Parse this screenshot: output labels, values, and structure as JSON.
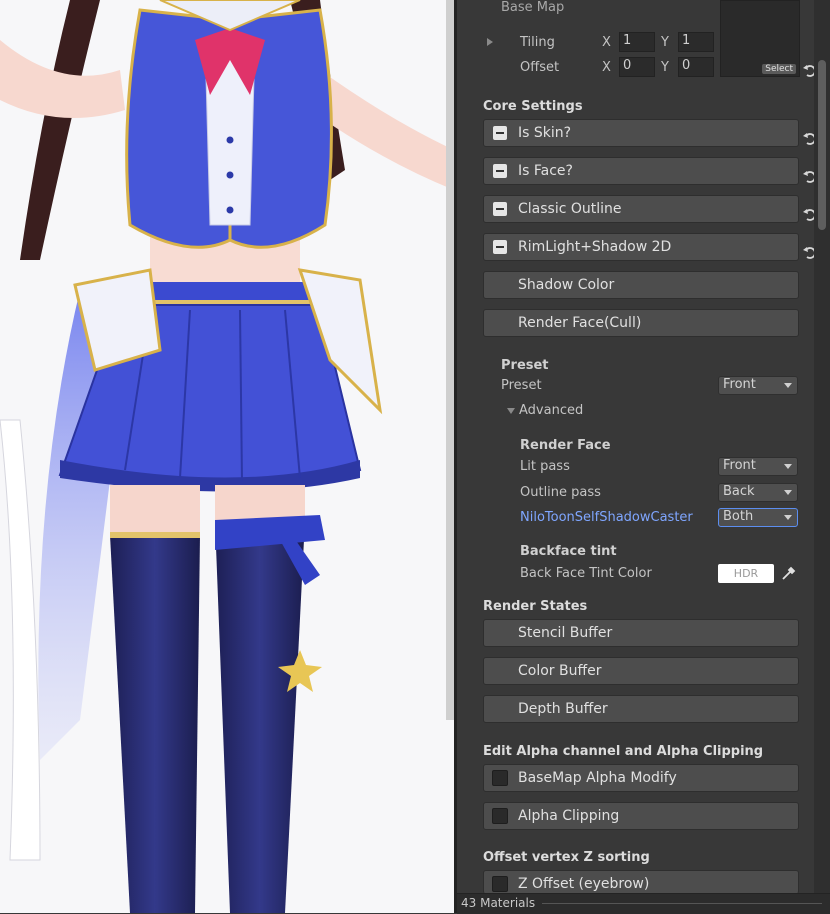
{
  "panel": {
    "texture": {
      "base_map": "Base Map",
      "tiling_label": "Tiling",
      "offset_label": "Offset",
      "x_label": "X",
      "y_label": "Y",
      "tiling_x": "1",
      "tiling_y": "1",
      "offset_x": "0",
      "offset_y": "0",
      "select_label": "Select"
    },
    "core_settings_header": "Core Settings",
    "core_items": [
      "Is Skin?",
      "Is Face?",
      "Classic Outline",
      "RimLight+Shadow 2D"
    ],
    "shadow_color": "Shadow Color",
    "render_face_cull": "Render Face(Cull)",
    "preset": {
      "header": "Preset",
      "label": "Preset",
      "value": "Front",
      "advanced": "Advanced"
    },
    "render_face": {
      "header": "Render Face",
      "lit_label": "Lit pass",
      "lit_value": "Front",
      "outline_label": "Outline pass",
      "outline_value": "Back",
      "shadowcaster_label": "NiloToonSelfShadowCaster",
      "shadowcaster_value": "Both"
    },
    "backface": {
      "header": "Backface tint",
      "label": "Back Face Tint Color",
      "hdr": "HDR"
    },
    "render_states_header": "Render States",
    "render_states": [
      "Stencil Buffer",
      "Color Buffer",
      "Depth Buffer"
    ],
    "alpha_header": "Edit Alpha channel and Alpha Clipping",
    "alpha_items": [
      "BaseMap Alpha Modify",
      "Alpha Clipping"
    ],
    "zsort_header": "Offset vertex Z sorting",
    "zsort_item": "Z Offset (eyebrow)",
    "footer": "43 Materials"
  },
  "colors": {
    "panel_bg": "#383838",
    "button_bg": "#4d4d4d",
    "link_blue": "#7fa6ff",
    "outfit_blue": "#3c4fd6"
  }
}
